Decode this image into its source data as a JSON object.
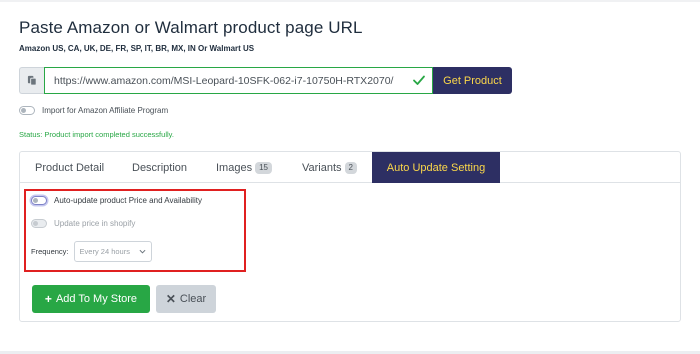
{
  "page": {
    "title": "Paste Amazon or Walmart product page URL",
    "subtitle": "Amazon US, CA, UK, DE, FR, SP, IT, BR, MX, IN Or Walmart US"
  },
  "url_input": {
    "value": "https://www.amazon.com/MSI-Leopard-10SFK-062-i7-10750H-RTX2070/",
    "addon_icon": "clipboard-icon",
    "valid_icon": "check-icon",
    "button_label": "Get Product"
  },
  "affiliate": {
    "label": "Import for Amazon Affiliate Program",
    "enabled": false
  },
  "status": {
    "text": "Status: Product import completed successfully."
  },
  "tabs": [
    {
      "label": "Product Detail",
      "badge": null
    },
    {
      "label": "Description",
      "badge": null
    },
    {
      "label": "Images",
      "badge": "15"
    },
    {
      "label": "Variants",
      "badge": "2"
    },
    {
      "label": "Auto Update Setting",
      "badge": null,
      "active": true
    }
  ],
  "auto_update": {
    "auto_label": "Auto-update product Price and Availability",
    "auto_enabled": false,
    "price_label": "Update price in shopify",
    "price_enabled": false,
    "frequency_label": "Frequency:",
    "frequency_value": "Every 24 hours"
  },
  "actions": {
    "add_label": "Add To My Store",
    "add_icon": "plus-icon",
    "clear_label": "Clear",
    "clear_icon": "times-icon"
  },
  "colors": {
    "brand_navy": "#2d2f63",
    "brand_yellow": "#fbd74a",
    "success_green": "#28a745",
    "highlight_red": "#e02020"
  }
}
